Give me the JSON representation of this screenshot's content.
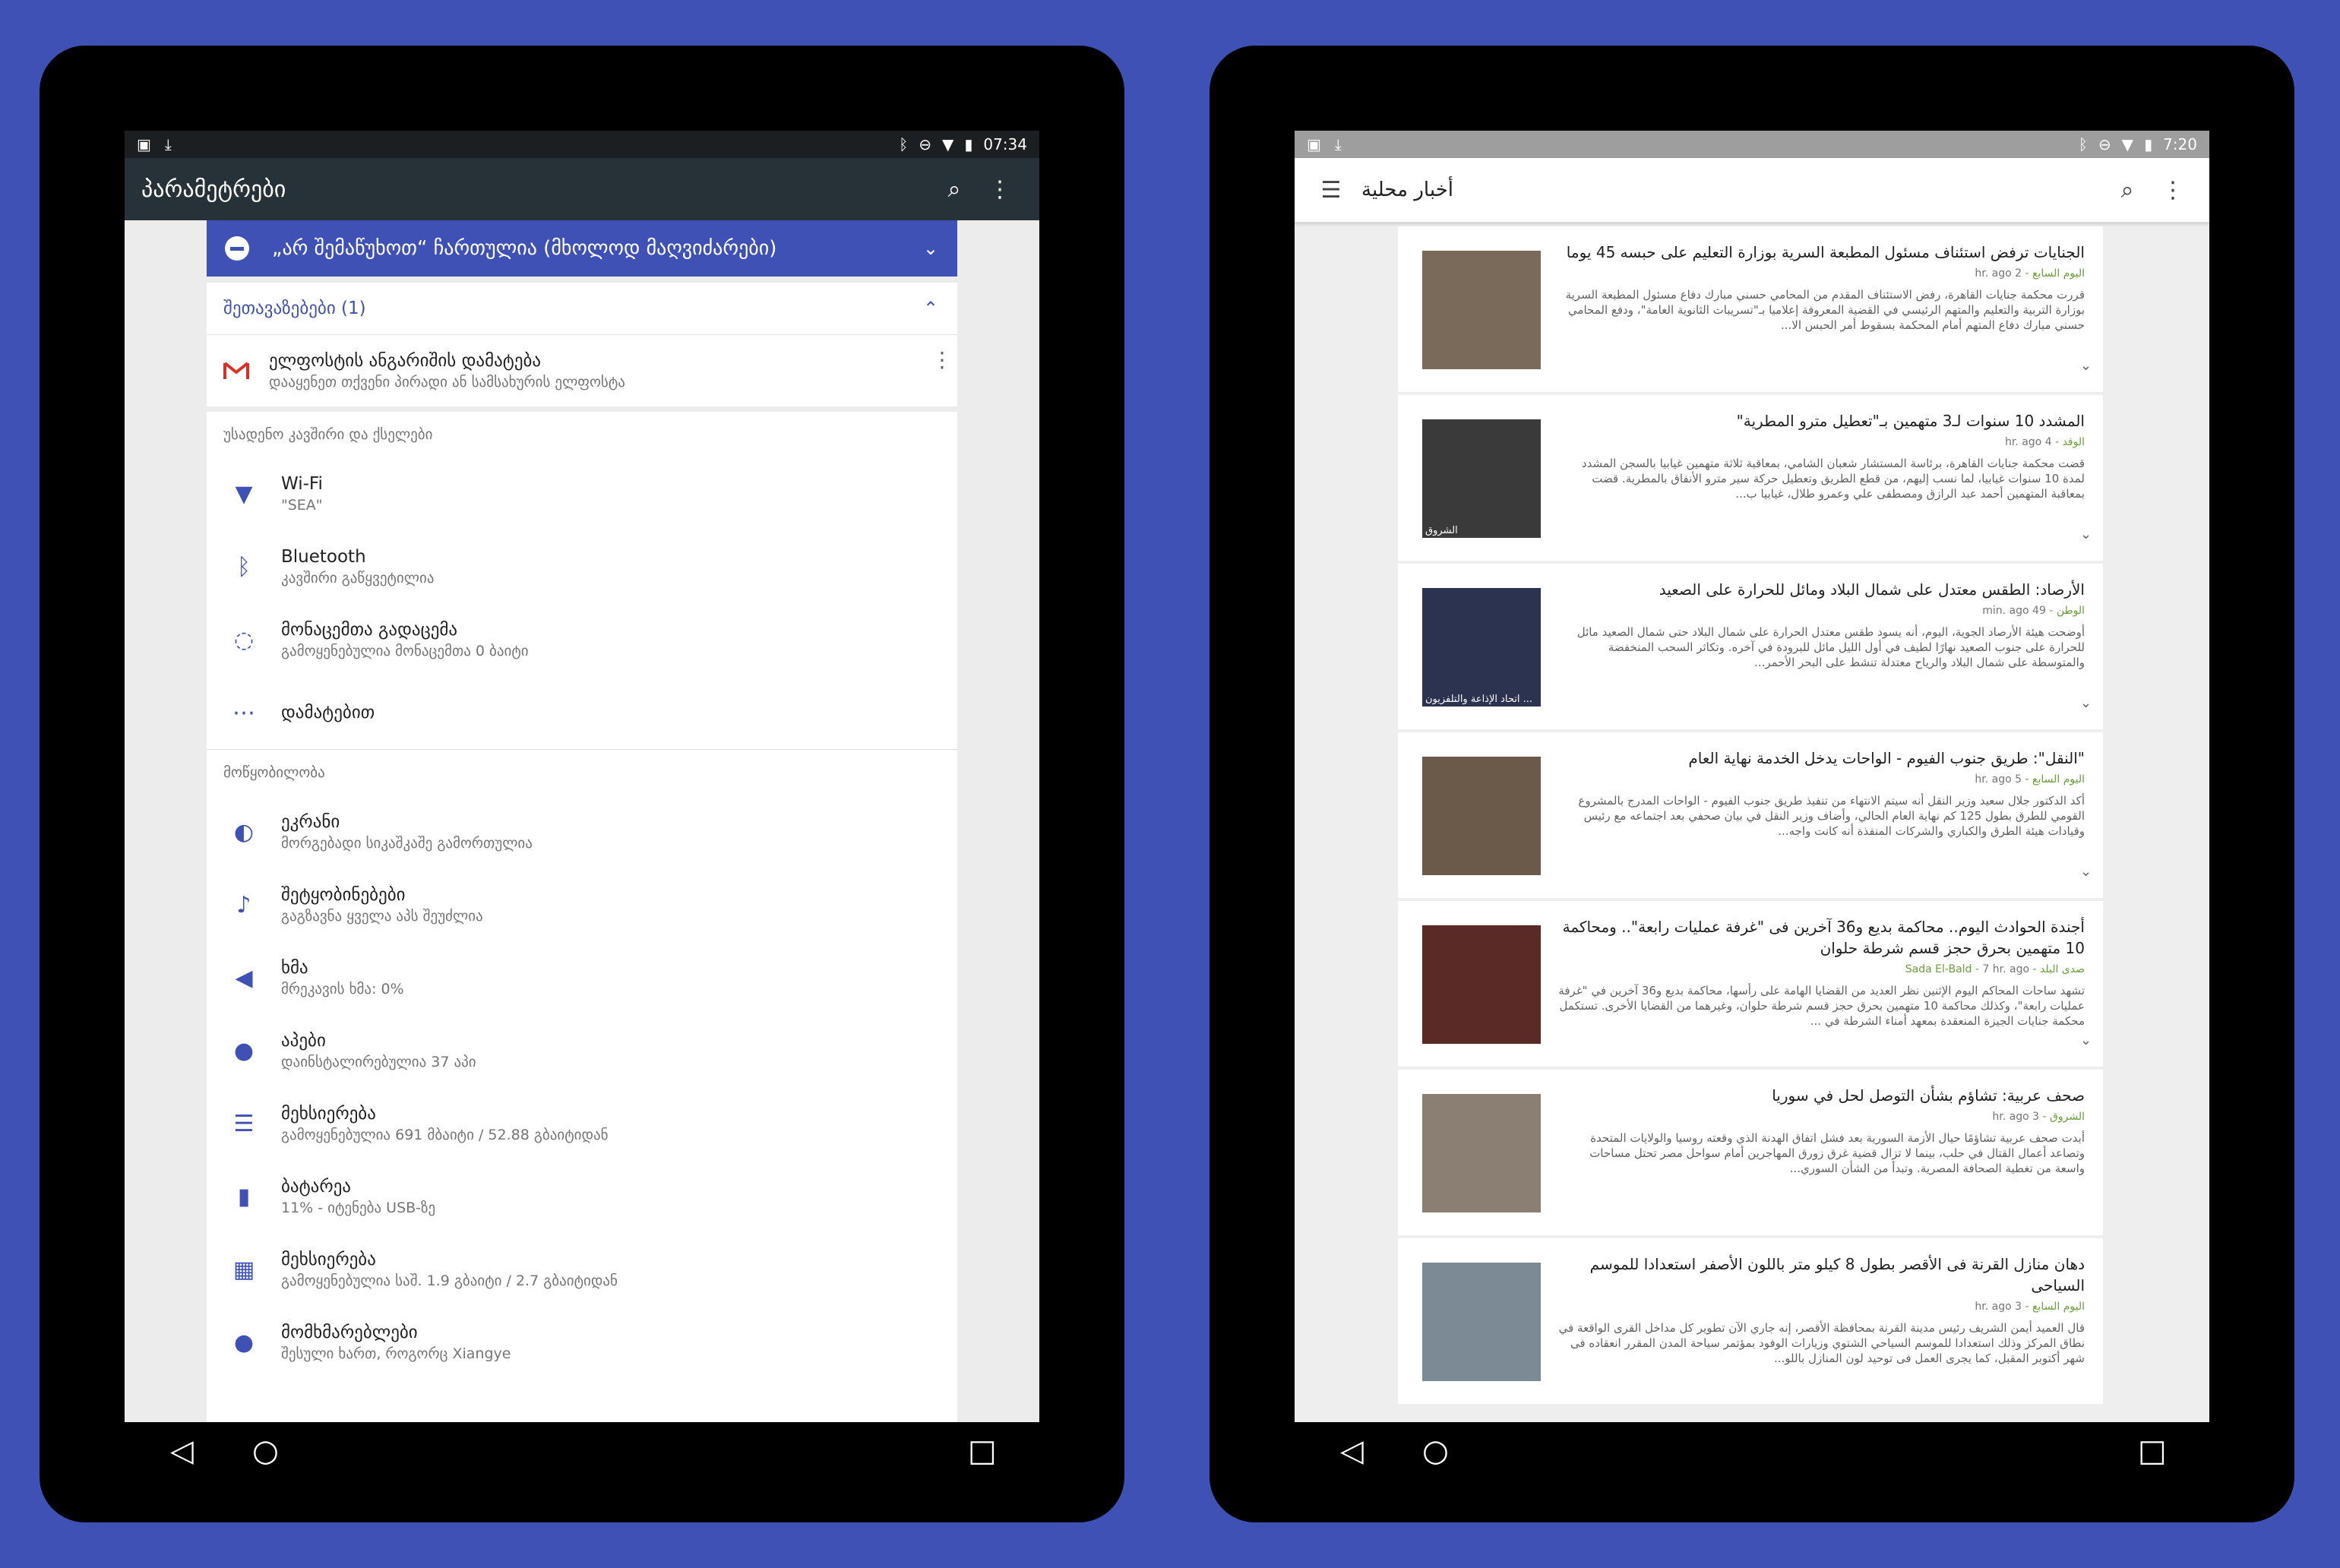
{
  "left_device": {
    "status": {
      "time": "07:34"
    },
    "toolbar": {
      "title": "პარამეტრები"
    },
    "dnd_banner": "„არ შემაწუხოთ“ ჩართულია (მხოლოდ მაღვიძარები)",
    "suggestions": {
      "header": "შეთავაზებები (1)",
      "item": {
        "title": "ელფოსტის ანგარიშის დამატება",
        "subtitle": "დააყენეთ თქვენი პირადი ან სამსახურის ელფოსტა"
      }
    },
    "sections": [
      {
        "header": "უსადენო კავშირი და ქსელები",
        "items": [
          {
            "title": "Wi-Fi",
            "subtitle": "\"SEA\"",
            "icon": "wifi-icon"
          },
          {
            "title": "Bluetooth",
            "subtitle": "კავშირი გაწყვეტილია",
            "icon": "bluetooth-icon"
          },
          {
            "title": "მონაცემთა გადაცემა",
            "subtitle": "გამოყენებულია მონაცემთა 0 ბაიტი",
            "icon": "data-usage-icon"
          },
          {
            "title": "დამატებით",
            "subtitle": "",
            "icon": "more-icon"
          }
        ]
      },
      {
        "header": "მოწყობილობა",
        "items": [
          {
            "title": "ეკრანი",
            "subtitle": "მორგებადი სიკაშკაშე გამორთულია",
            "icon": "display-icon"
          },
          {
            "title": "შეტყობინებები",
            "subtitle": "გაგზავნა ყველა აპს შეუძლია",
            "icon": "notifications-icon"
          },
          {
            "title": "ხმა",
            "subtitle": "მრეკავის ხმა: 0%",
            "icon": "sound-icon"
          },
          {
            "title": "აპები",
            "subtitle": "დაინსტალირებულია 37 აპი",
            "icon": "apps-icon"
          },
          {
            "title": "მეხსიერება",
            "subtitle": "გამოყენებულია 691 მბაიტი / 52.88 გბაიტიდან",
            "icon": "storage-icon"
          },
          {
            "title": "ბატარეა",
            "subtitle": "11% - იტენება USB-ზე",
            "icon": "battery-icon"
          },
          {
            "title": "მეხსიერება",
            "subtitle": "გამოყენებულია საშ. 1.9 გბაიტი / 2.7 გბაიტიდან",
            "icon": "memory-icon"
          },
          {
            "title": "მომხმარებლები",
            "subtitle": "შესული ხართ, როგორც Xiangye",
            "icon": "users-icon"
          }
        ]
      }
    ]
  },
  "right_device": {
    "status": {
      "time": "7:20"
    },
    "toolbar": {
      "title": "أخبار محلية"
    },
    "articles": [
      {
        "title": "الجنايات ترفض استئناف مسئول المطبعة السرية بوزارة التعليم على حبسه 45 يوما",
        "source": "اليوم السابع",
        "ago": "2 hr. ago",
        "snippet": "قررت محكمة جنايات القاهرة، رفض الاستئناف المقدم من المحامي حسني مبارك دفاع مسئول المطبعة السرية بوزارة التربية والتعليم والمتهم الرئيسي في القضية المعروفة إعلاميا بـ\"تسريبات الثانوية العامة\"، ودفع المحامي حسني مبارك دفاع المتهم أمام المحكمة بسقوط أمر الحبس الا...",
        "thumb_color": "#7a6a5a",
        "caption": ""
      },
      {
        "title": "المشدد 10 سنوات لـ3 متهمين بـ\"تعطيل مترو المطرية\"",
        "source": "الوفد",
        "ago": "4 hr. ago",
        "snippet": "قضت محكمة جنايات القاهرة، برئاسة المستشار شعبان الشامي، بمعاقبة ثلاثة متهمين غيابيا بالسجن المشدد لمدة 10 سنوات غيابيا، لما نسب إليهم، من قطع الطريق وتعطيل حركة سير مترو الأنفاق بالمطرية. قضت بمعاقبة المتهمين أحمد عبد الرازق ومصطفى علي وعمرو طلال، غيابيا ب...",
        "thumb_color": "#3a3a3a",
        "caption": "الشروق"
      },
      {
        "title": "الأرصاد: الطقس معتدل على شمال البلاد ومائل للحرارة على الصعيد",
        "source": "الوطن",
        "ago": "49 min. ago",
        "snippet": "أوضحت هيئة الأرصاد الجوية، اليوم، أنه يسود طقس معتدل الحرارة على شمال البلاد حتى شمال الصعيد مائل للحرارة على جنوب الصعيد نهارًا لطيف في أول الليل مائل للبرودة في آخره. وتكاثر السحب المنخفضة والمتوسطة على شمال البلاد والرياح معتدلة تنشط على البحر الأحمر...",
        "thumb_color": "#2c3350",
        "caption": "اتحاد الإذاعة والتلفزيون ..."
      },
      {
        "title": "\"النقل\": طريق جنوب الفيوم - الواحات يدخل الخدمة نهاية العام",
        "source": "اليوم السابع",
        "ago": "5 hr. ago",
        "snippet": "أكد الدكتور جلال سعيد وزير النقل أنه سيتم الانتهاء من تنفيذ طريق جنوب الفيوم - الواحات المدرج بالمشروع القومي للطرق بطول 125 كم نهاية العام الحالي، وأضاف وزير النقل في بيان صحفي بعد اجتماعه مع رئيس وقيادات هيئة الطرق والكباري والشركات المنفذة أنه كانت واجه...",
        "thumb_color": "#6b5a4a",
        "caption": ""
      },
      {
        "title": "أجندة الحوادث اليوم.. محاكمة بديع و36 آخرين فى \"غرفة عمليات رابعة\".. ومحاكمة 10 متهمين بحرق حجز قسم شرطة حلوان",
        "source": "صدى البلد - Sada El-Bald",
        "ago": "7 hr. ago",
        "snippet": "تشهد ساحات المحاكم اليوم الإثنين نظر العديد من القضايا الهامة على رأسها، محاكمة بديع و36 آخرين في \"غرفة عمليات رابعة\"، وكذلك محاكمة 10 متهمين بحرق حجز قسم شرطة حلوان، وغيرهما من القضايا الأخرى. تستكمل محكمة جنايات الجيزة المنعقدة بمعهد أمناء الشرطة في ...",
        "thumb_color": "#5a2a26",
        "caption": ""
      },
      {
        "title": "صحف عربية: تشاؤم بشأن التوصل لحل في سوريا",
        "source": "الشروق",
        "ago": "3 hr. ago",
        "snippet": "أبدت صحف عربية تشاؤمًا حيال الأزمة السورية بعد فشل اتفاق الهدنة الذي وقعته روسيا والولايات المتحدة وتصاعد أعمال القتال في حلب، بينما لا تزال قضية غرق زورق المهاجرين أمام سواحل مصر تحتل مساحات واسعة من تغطية الصحافة المصرية. وتبدأ من الشأن السوري...",
        "thumb_color": "#8a7f72",
        "caption": ""
      },
      {
        "title": "دهان منازل القرنة فى الأقصر بطول 8 كيلو متر باللون الأصفر استعدادا للموسم السياحى",
        "source": "اليوم السابع",
        "ago": "3 hr. ago",
        "snippet": "قال العميد أيمن الشريف رئيس مدينة القرنة بمحافظة الأقصر، إنه جاري الآن تطوير كل مداخل القرى الواقعة في نطاق المركز وذلك استعدادا للموسم السياحي الشتوي وزيارات الوفود بمؤتمر سياحة المدن المقرر انعقاده فى شهر أكتوبر المقبل، كما يجرى العمل فى توحيد لون المنازل باللو...",
        "thumb_color": "#7c8a96",
        "caption": ""
      }
    ]
  }
}
